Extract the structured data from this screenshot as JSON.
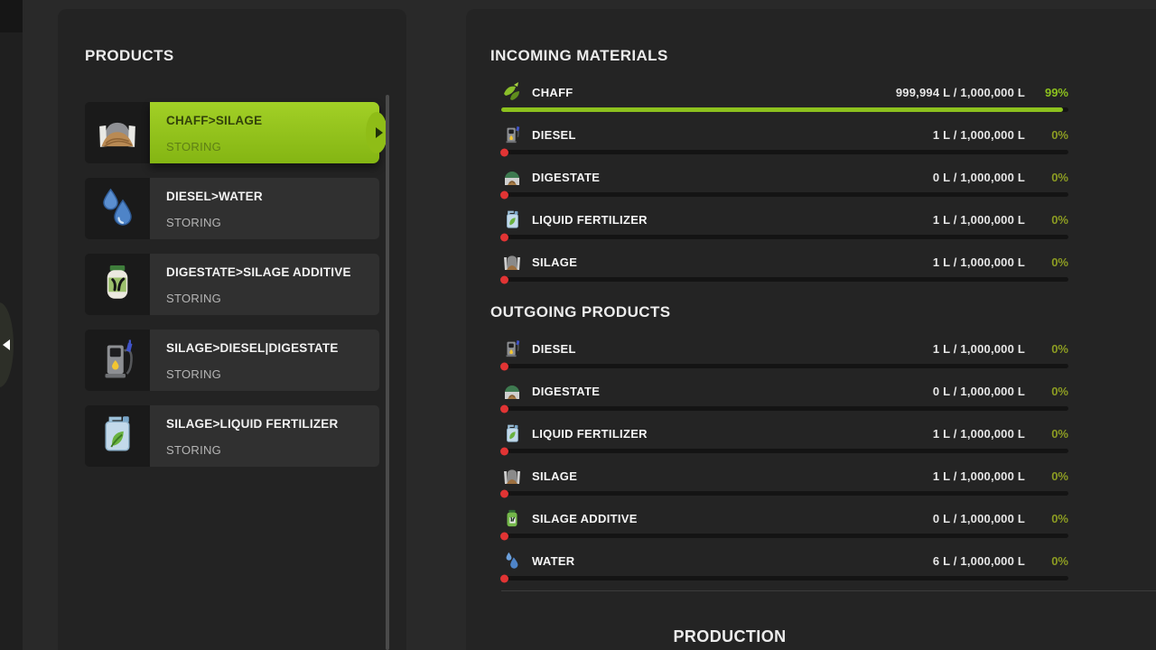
{
  "left_panel": {
    "title": "PRODUCTS",
    "products": [
      {
        "name": "CHAFF>SILAGE",
        "status": "STORING",
        "icon": "bunker-silo-icon",
        "selected": true
      },
      {
        "name": "DIESEL>WATER",
        "status": "STORING",
        "icon": "water-drops-icon",
        "selected": false
      },
      {
        "name": "DIGESTATE>SILAGE ADDITIVE",
        "status": "STORING",
        "icon": "additive-jar-icon",
        "selected": false
      },
      {
        "name": "SILAGE>DIESEL|DIGESTATE",
        "status": "STORING",
        "icon": "fuel-pump-icon",
        "selected": false
      },
      {
        "name": "SILAGE>LIQUID FERTILIZER",
        "status": "STORING",
        "icon": "jerry-can-leaf-icon",
        "selected": false
      }
    ]
  },
  "right_panel": {
    "incoming": {
      "title": "INCOMING MATERIALS",
      "rows": [
        {
          "label": "CHAFF",
          "amount": "999,994 L / 1,000,000 L",
          "percent": "99%",
          "fill": 0.99,
          "icon": "chaff-icon"
        },
        {
          "label": "DIESEL",
          "amount": "1 L / 1,000,000 L",
          "percent": "0%",
          "fill": 0,
          "icon": "diesel-pump-icon"
        },
        {
          "label": "DIGESTATE",
          "amount": "0 L / 1,000,000 L",
          "percent": "0%",
          "fill": 0,
          "icon": "digestate-dome-icon"
        },
        {
          "label": "LIQUID FERTILIZER",
          "amount": "1 L / 1,000,000 L",
          "percent": "0%",
          "fill": 0,
          "icon": "liquid-fertilizer-icon"
        },
        {
          "label": "SILAGE",
          "amount": "1 L / 1,000,000 L",
          "percent": "0%",
          "fill": 0,
          "icon": "silage-heap-icon"
        }
      ]
    },
    "outgoing": {
      "title": "OUTGOING PRODUCTS",
      "rows": [
        {
          "label": "DIESEL",
          "amount": "1 L / 1,000,000 L",
          "percent": "0%",
          "fill": 0,
          "icon": "diesel-pump-icon"
        },
        {
          "label": "DIGESTATE",
          "amount": "0 L / 1,000,000 L",
          "percent": "0%",
          "fill": 0,
          "icon": "digestate-dome-icon"
        },
        {
          "label": "LIQUID FERTILIZER",
          "amount": "1 L / 1,000,000 L",
          "percent": "0%",
          "fill": 0,
          "icon": "liquid-fertilizer-icon"
        },
        {
          "label": "SILAGE",
          "amount": "1 L / 1,000,000 L",
          "percent": "0%",
          "fill": 0,
          "icon": "silage-heap-icon"
        },
        {
          "label": "SILAGE ADDITIVE",
          "amount": "0 L / 1,000,000 L",
          "percent": "0%",
          "fill": 0,
          "icon": "silage-additive-icon"
        },
        {
          "label": "WATER",
          "amount": "6 L / 1,000,000 L",
          "percent": "0%",
          "fill": 0,
          "icon": "water-drop-icon"
        }
      ]
    },
    "production_title": "PRODUCTION"
  },
  "colors": {
    "accent_green": "#8cc11e",
    "percent_low_green": "#8c9c22",
    "bar_empty_red": "#e13434",
    "selected_gradient_top": "#a2d026",
    "selected_gradient_bottom": "#84b513",
    "panel_bg": "#232323",
    "row_bg": "#303030"
  }
}
